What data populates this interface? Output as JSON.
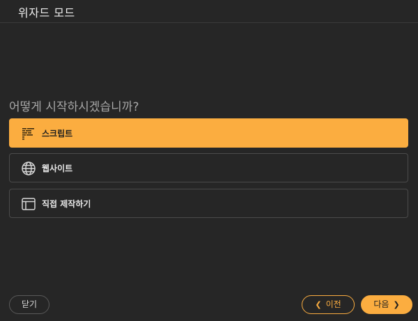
{
  "window": {
    "title": "위자드 모드"
  },
  "main": {
    "question": "어떻게 시작하시겠습니까?",
    "options": [
      {
        "label": "스크립트",
        "icon": "script-icon",
        "selected": true
      },
      {
        "label": "웹사이트",
        "icon": "globe-icon",
        "selected": false
      },
      {
        "label": "직접 제작하기",
        "icon": "layout-icon",
        "selected": false
      }
    ]
  },
  "footer": {
    "close_label": "닫기",
    "prev_label": "이전",
    "next_label": "다음"
  },
  "colors": {
    "background": "#262626",
    "accent": "#fbad40",
    "border": "#4b4b4b"
  }
}
